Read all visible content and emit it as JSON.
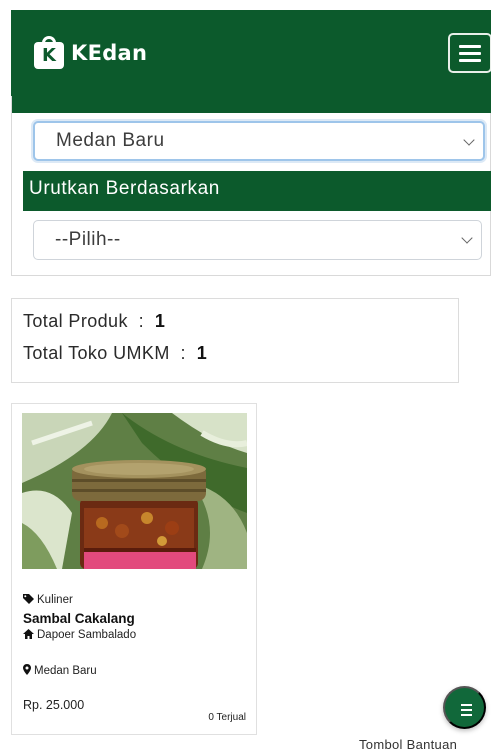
{
  "header": {
    "brand_letter": "K",
    "brand_name": "KEdan",
    "menu_icon": "hamburger-menu-icon",
    "brand_color": "#0c5a2c"
  },
  "filters": {
    "location_select": {
      "selected": "Medan Baru"
    },
    "sort_label": "Urutkan Berdasarkan",
    "sort_select": {
      "selected": "--Pilih--"
    }
  },
  "summary": {
    "products_label": "Total Produk",
    "products_sep": ":",
    "products_value": "1",
    "shops_label": "Total Toko UMKM",
    "shops_sep": ":",
    "shops_value": "1"
  },
  "products": [
    {
      "category": "Kuliner",
      "category_icon": "tag-icon",
      "name": "Sambal Cakalang",
      "shop": "Dapoer Sambalado",
      "shop_icon": "home-icon",
      "location": "Medan Baru",
      "location_icon": "map-marker-icon",
      "price": "Rp. 25.000",
      "sold": "0 Terjual"
    }
  ],
  "help": {
    "icon": "menu-lines-icon",
    "label": "Tombol Bantuan"
  }
}
